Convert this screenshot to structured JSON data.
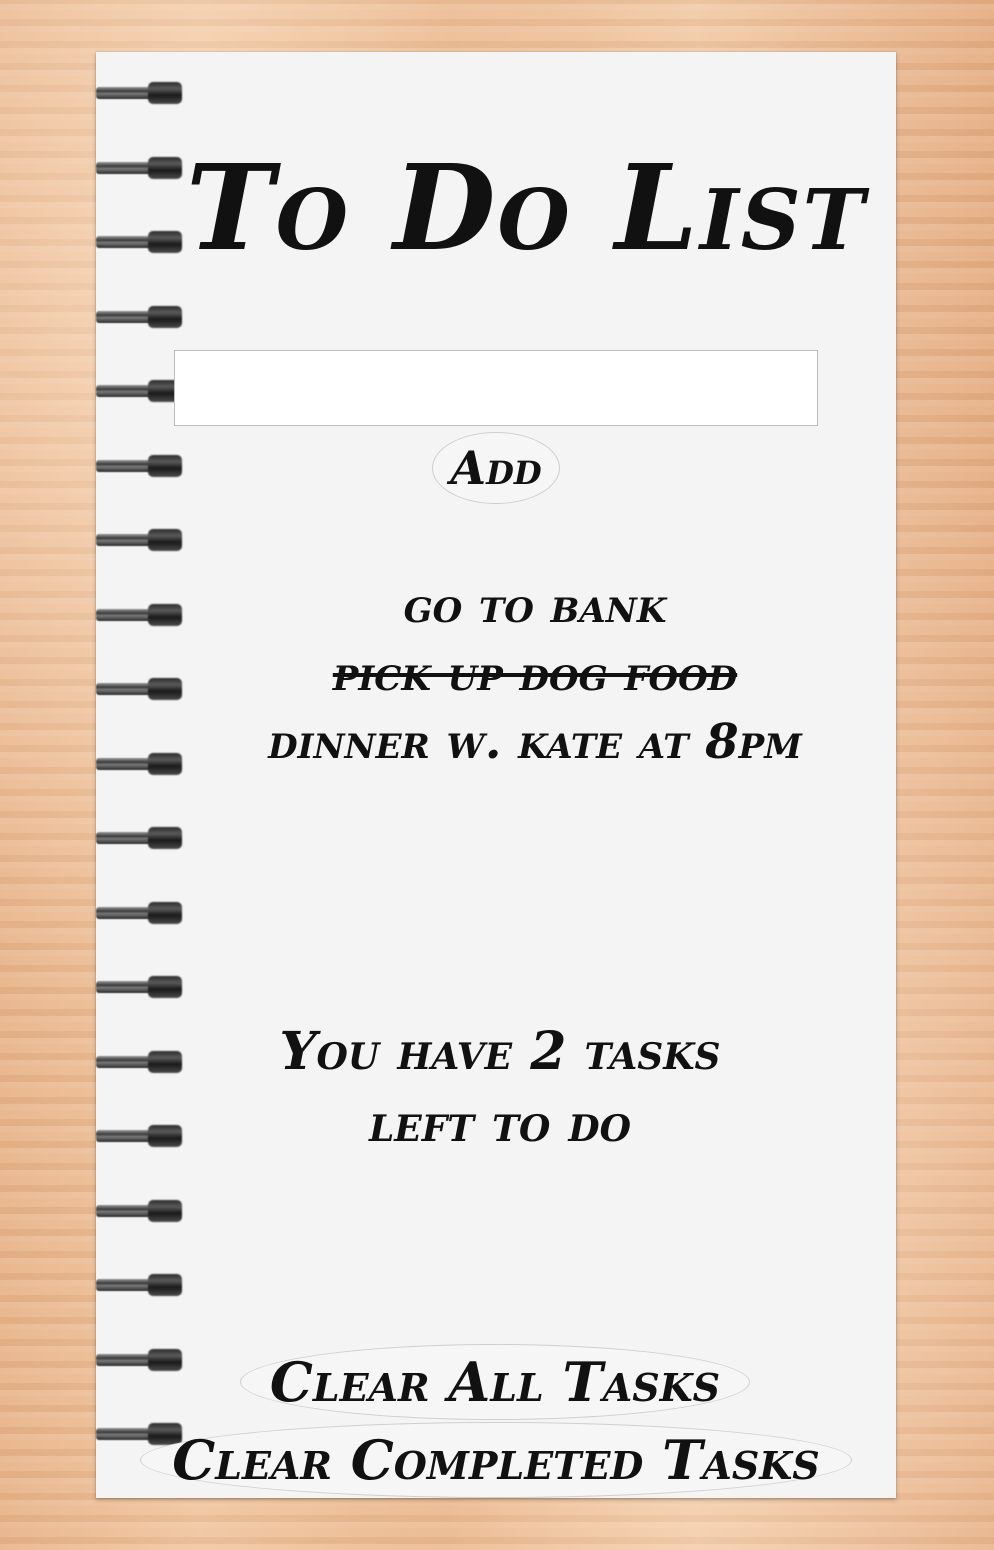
{
  "app": {
    "title": "To Do List"
  },
  "input": {
    "value": "",
    "placeholder": ""
  },
  "buttons": {
    "add": "Add",
    "clear_all": "Clear All Tasks",
    "clear_completed": "Clear Completed Tasks"
  },
  "tasks": [
    {
      "text": "go to bank",
      "completed": false
    },
    {
      "text": "pick up dog food",
      "completed": true
    },
    {
      "text": "dinner w. kate at 8pm",
      "completed": false
    }
  ],
  "status": {
    "line1": "You have 2 tasks",
    "line2": "left to do"
  },
  "colors": {
    "paper": "#f4f4f4",
    "ink": "#111111",
    "wood": "#eab88e"
  }
}
